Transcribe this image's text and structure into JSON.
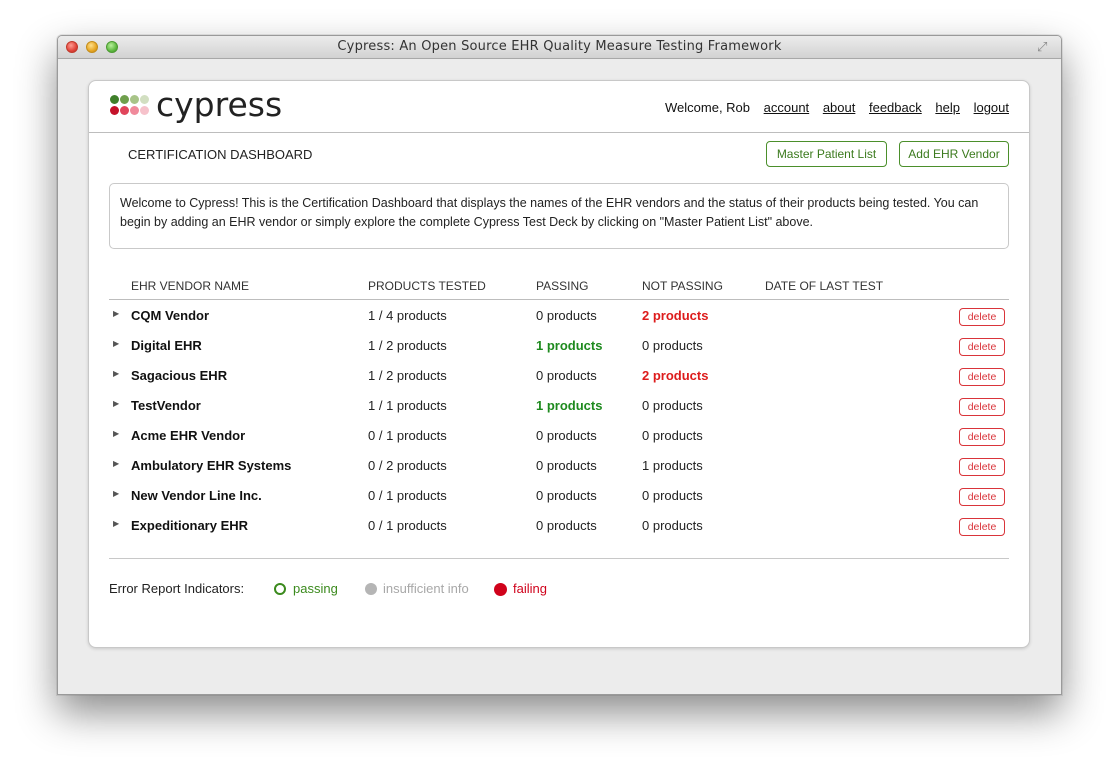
{
  "window": {
    "title": "Cypress: An Open Source EHR Quality Measure Testing Framework"
  },
  "header": {
    "logo_text": "cypress",
    "welcome": "Welcome, Rob",
    "nav": [
      "account",
      "about",
      "feedback",
      "help",
      "logout"
    ]
  },
  "dashboard": {
    "title": "CERTIFICATION DASHBOARD",
    "master_patient_list_label": "Master Patient List",
    "add_vendor_label": "Add EHR Vendor",
    "intro": "Welcome to Cypress! This is the Certification Dashboard that displays the names of the EHR vendors and the status of their products being tested. You can begin by adding an EHR vendor or simply explore the complete Cypress Test Deck by clicking on \"Master Patient List\" above."
  },
  "table": {
    "headers": [
      "EHR VENDOR NAME",
      "PRODUCTS TESTED",
      "PASSING",
      "NOT PASSING",
      "DATE OF LAST TEST"
    ],
    "rows": [
      {
        "name": "CQM Vendor",
        "tested": "1 / 4 products",
        "passing": "0 products",
        "not_passing": "2 products",
        "date": "",
        "delete": "delete"
      },
      {
        "name": "Digital EHR",
        "tested": "1 / 2 products",
        "passing": "1 products",
        "not_passing": "0 products",
        "date": "",
        "delete": "delete"
      },
      {
        "name": "Sagacious EHR",
        "tested": "1 / 2 products",
        "passing": "0 products",
        "not_passing": "2 products",
        "date": "",
        "delete": "delete"
      },
      {
        "name": "TestVendor",
        "tested": "1 / 1 products",
        "passing": "1 products",
        "not_passing": "0 products",
        "date": "",
        "delete": "delete"
      },
      {
        "name": "Acme EHR Vendor",
        "tested": "0 / 1 products",
        "passing": "0 products",
        "not_passing": "0 products",
        "date": "",
        "delete": "delete"
      },
      {
        "name": "Ambulatory EHR Systems",
        "tested": "0 / 2 products",
        "passing": "0 products",
        "not_passing": "1 products",
        "date": "",
        "delete": "delete"
      },
      {
        "name": "New Vendor Line Inc.",
        "tested": "0 / 1 products",
        "passing": "0 products",
        "not_passing": "0 products",
        "date": "",
        "delete": "delete"
      },
      {
        "name": "Expeditionary EHR",
        "tested": "0 / 1 products",
        "passing": "0 products",
        "not_passing": "0 products",
        "date": "",
        "delete": "delete"
      }
    ]
  },
  "legend": {
    "label": "Error Report Indicators:",
    "passing": "passing",
    "insufficient": "insufficient info",
    "failing": "failing"
  },
  "colors": {
    "accent_green": "#3b7a1d",
    "pass_green": "#1f8a1f",
    "fail_red": "#dd1c1c",
    "neutral_gray": "#b5b5b5"
  }
}
